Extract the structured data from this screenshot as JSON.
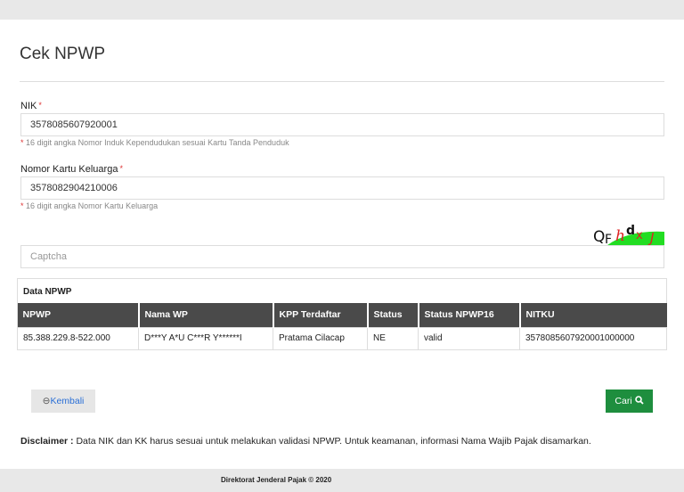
{
  "title": "Cek NPWP",
  "nik": {
    "label": "NIK",
    "required": "*",
    "value": "3578085607920001",
    "help": "16 digit angka Nomor Induk Kependudukan sesuai Kartu Tanda Penduduk"
  },
  "kk": {
    "label": "Nomor Kartu Keluarga",
    "required": "*",
    "value": "3578082904210006",
    "help": "16 digit angka Nomor Kartu Keluarga"
  },
  "captcha": {
    "image_text": "QFhdxJ",
    "placeholder": "Captcha"
  },
  "table": {
    "title": "Data NPWP",
    "headers": [
      "NPWP",
      "Nama WP",
      "KPP Terdaftar",
      "Status",
      "Status NPWP16",
      "NITKU"
    ],
    "rows": [
      [
        "85.388.229.8-522.000",
        "D***Y A*U C***R Y******I",
        "Pratama Cilacap",
        "NE",
        "valid",
        "3578085607920001000000"
      ]
    ]
  },
  "buttons": {
    "back": "Kembali",
    "search": "Cari"
  },
  "disclaimer": {
    "label": "Disclaimer :",
    "text": " Data NIK dan KK harus sesuai untuk melakukan validasi NPWP. Untuk keamanan, informasi Nama Wajib Pajak disamarkan."
  },
  "footer": "Direktorat Jenderal Pajak © 2020"
}
